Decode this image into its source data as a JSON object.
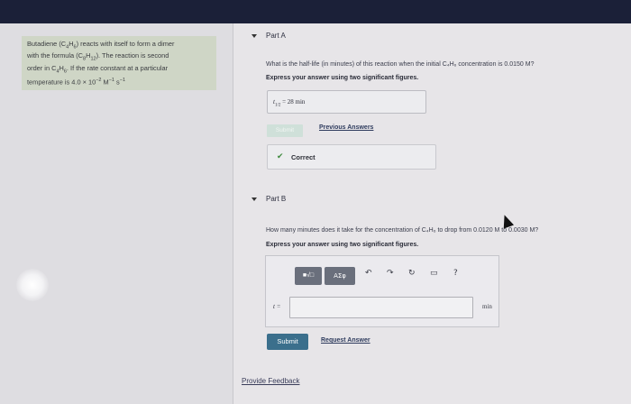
{
  "problem": {
    "line1_pre": "Butadiene (C",
    "line1_sub1": "4",
    "line1_mid": "H",
    "line1_sub2": "6",
    "line1_post": ") reacts with itself to form a dimer",
    "line2_pre": "with the formula (C",
    "line2_sub1": "8",
    "line2_mid": "H",
    "line2_sub2": "12",
    "line2_post": "). The reaction is second",
    "line3_pre": "order in C",
    "line3_sub1": "4",
    "line3_mid": "H",
    "line3_sub2": "6",
    "line3_post": ". If the rate constant at a particular",
    "line4_pre": "temperature is 4.0 × 10",
    "line4_exp1": "−2",
    "line4_unit1": " M",
    "line4_exp2": "−1",
    "line4_unit2": " s",
    "line4_exp3": "−1"
  },
  "partA": {
    "title": "Part A",
    "question": "What is the half-life (in minutes) of this reaction when the initial C₄H₆ concentration is 0.0150 M?",
    "instruction": "Express your answer using two significant figures.",
    "answer_label": "t",
    "answer_sub": "1/2",
    "answer_value": "=  28  min",
    "submit_label": "Submit",
    "previous_answers": "Previous Answers",
    "feedback": "Correct"
  },
  "partB": {
    "title": "Part B",
    "question": "How many minutes does it take for the concentration of C₄H₆ to drop from 0.0120 M to 0.0030 M?",
    "instruction": "Express your answer using two significant figures.",
    "toolbar": {
      "templates_label": "■√□",
      "greek_label": "ΑΣφ",
      "undo_icon": "↶",
      "redo_icon": "↷",
      "reset_icon": "↻",
      "keyboard_icon": "▭",
      "help_icon": "?"
    },
    "var_label": "t =",
    "input_value": "",
    "unit": "min",
    "submit_label": "Submit",
    "request_answer": "Request Answer"
  },
  "footer": {
    "provide_feedback": "Provide Feedback"
  }
}
